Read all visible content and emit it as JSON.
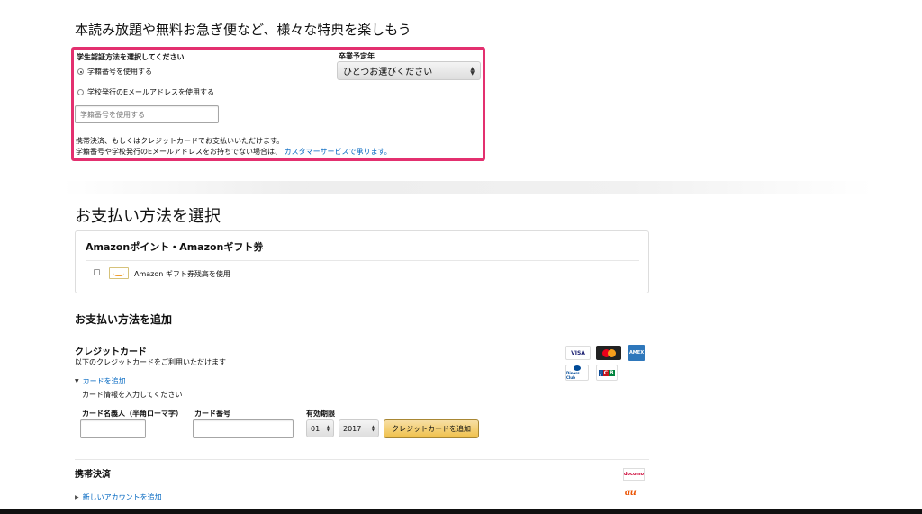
{
  "promo": {
    "title": "本読み放題や無料お急ぎ便など、様々な特典を楽しもう"
  },
  "student": {
    "method_label": "学生認証方法を選択してください",
    "radio_student_id": "学籍番号を使用する",
    "radio_school_email": "学校発行のEメールアドレスを使用する",
    "input_placeholder": "学籍番号を使用する",
    "grad_label": "卒業予定年",
    "grad_select_value": "ひとつお選びください",
    "note_line1": "携帯決済、もしくはクレジットカードでお支払いいただけます。",
    "note_line2_prefix": "学籍番号や学校発行のEメールアドレスをお持ちでない場合は、",
    "note_line2_link": "カスタマーサービスで承ります。"
  },
  "payment": {
    "section_title": "お支払い方法を選択",
    "gift_title": "Amazonポイント・Amazonギフト券",
    "gift_checkbox_label": "Amazon ギフト券残高を使用"
  },
  "add_payment": {
    "title": "お支払い方法を追加",
    "credit_title": "クレジットカード",
    "credit_subtitle": "以下のクレジットカードをご利用いただけます",
    "add_card_link": "カードを追加",
    "card_info_label": "カード情報を入力してください",
    "cardholder_label": "カード名義人（半角ローマ字）",
    "card_number_label": "カード番号",
    "expiry_label": "有効期限",
    "expiry_month": "01",
    "expiry_year": "2017",
    "add_card_button": "クレジットカードを追加",
    "card_brands": {
      "visa": "VISA",
      "mastercard": "MasterCard",
      "amex": "AMEX",
      "diners": "Diners Club",
      "jcb": "JCB"
    },
    "mobile_title": "携帯決済",
    "new_account_link": "新しいアカウントを追加",
    "carrier_docomo": "docomo",
    "carrier_au": "au"
  },
  "colors": {
    "highlight": "#e3306f",
    "link": "#0066c0",
    "button": "#f0c14b"
  }
}
